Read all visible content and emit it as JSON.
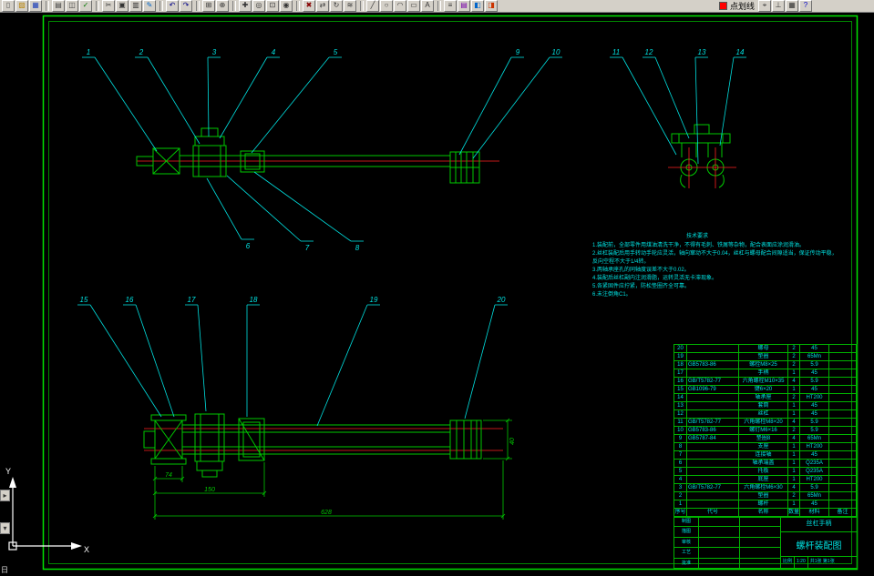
{
  "toolbar": {
    "groups": [
      {
        "items": [
          {
            "name": "new-file",
            "glyph": "▯",
            "color": "#555555"
          },
          {
            "name": "open-file",
            "glyph": "▨",
            "color": "#b8860b"
          },
          {
            "name": "save-file",
            "glyph": "▦",
            "color": "#2244bb"
          }
        ]
      },
      {
        "items": [
          {
            "name": "print",
            "glyph": "▤",
            "color": "#444444"
          },
          {
            "name": "print-preview",
            "glyph": "◫",
            "color": "#444444"
          },
          {
            "name": "spell-check",
            "glyph": "✓",
            "color": "#007700"
          }
        ]
      },
      {
        "items": [
          {
            "name": "cut",
            "glyph": "✂",
            "color": "#333333"
          },
          {
            "name": "copy",
            "glyph": "▣",
            "color": "#333333"
          },
          {
            "name": "paste",
            "glyph": "▥",
            "color": "#333333"
          },
          {
            "name": "format-painter",
            "glyph": "✎",
            "color": "#0066cc"
          }
        ]
      },
      {
        "items": [
          {
            "name": "undo",
            "glyph": "↶",
            "color": "#000088"
          },
          {
            "name": "redo",
            "glyph": "↷",
            "color": "#000088"
          }
        ]
      },
      {
        "items": [
          {
            "name": "insert-block",
            "glyph": "⊞",
            "color": "#333333"
          },
          {
            "name": "insert-hyperlink",
            "glyph": "⊕",
            "color": "#333333"
          }
        ]
      },
      {
        "items": [
          {
            "name": "pan",
            "glyph": "✚",
            "color": "#333333"
          },
          {
            "name": "zoom-realtime",
            "glyph": "◎",
            "color": "#333333"
          },
          {
            "name": "zoom-window",
            "glyph": "⊡",
            "color": "#333333"
          },
          {
            "name": "zoom-previous",
            "glyph": "◉",
            "color": "#333333"
          }
        ]
      },
      {
        "items": [
          {
            "name": "erase",
            "glyph": "✖",
            "color": "#880000"
          },
          {
            "name": "move",
            "glyph": "⇄",
            "color": "#333333"
          },
          {
            "name": "rotate",
            "glyph": "↻",
            "color": "#333333"
          },
          {
            "name": "offset",
            "glyph": "≋",
            "color": "#333333"
          }
        ]
      },
      {
        "items": [
          {
            "name": "line",
            "glyph": "╱",
            "color": "#333333"
          },
          {
            "name": "circle",
            "glyph": "○",
            "color": "#333333"
          },
          {
            "name": "arc",
            "glyph": "◠",
            "color": "#333333"
          },
          {
            "name": "rectangle",
            "glyph": "▭",
            "color": "#333333"
          },
          {
            "name": "text",
            "glyph": "A",
            "color": "#333333"
          }
        ]
      },
      {
        "items": [
          {
            "name": "layers",
            "glyph": "≡",
            "color": "#333333"
          },
          {
            "name": "layer-control",
            "glyph": "▤",
            "color": "#7700aa"
          },
          {
            "name": "properties",
            "glyph": "◧",
            "color": "#0066cc"
          },
          {
            "name": "design-center",
            "glyph": "◨",
            "color": "#cc3300"
          }
        ]
      }
    ],
    "linetype": {
      "label": "点划线",
      "color": "#ff0000"
    },
    "right_groups": [
      {
        "items": [
          {
            "name": "object-snap",
            "glyph": "⌖",
            "color": "#333333"
          },
          {
            "name": "ortho",
            "glyph": "⊥",
            "color": "#333333"
          },
          {
            "name": "grid",
            "glyph": "▦",
            "color": "#333333"
          },
          {
            "name": "help",
            "glyph": "?",
            "color": "#0000cc"
          }
        ]
      }
    ]
  },
  "callouts": {
    "top": [
      "1",
      "2",
      "3",
      "4",
      "5",
      "9",
      "10"
    ],
    "top_below": [
      "6",
      "7",
      "8"
    ],
    "end_view": [
      "11",
      "12",
      "13",
      "14"
    ],
    "bottom": [
      "15",
      "16",
      "17",
      "18",
      "19",
      "20"
    ]
  },
  "dimensions": {
    "d1": "74",
    "d2": "150",
    "d3": "628",
    "d4": "40"
  },
  "notes": {
    "title": "技术要求",
    "lines": [
      "1.装配前，全部零件用煤油清洗干净，不得有毛刺、铁屑等杂物，配合表面应涂润滑油。",
      "2.丝杠装配后用手转动手轮应灵活，轴向窜动不大于0.04，丝杠与螺母配合间隙适当，保证传动平稳，",
      "  反向空程不大于1/4转。",
      "3.两轴承座孔的同轴度误差不大于0.02。",
      "4.装配后丝杠副内注润滑脂，运转灵活无卡滞现象。",
      "5.各紧固件应拧紧，防松垫圈齐全可靠。",
      "6.未注倒角C1。"
    ]
  },
  "bom": {
    "header": [
      "序号",
      "代号",
      "名称",
      "数量",
      "材料",
      "备注"
    ],
    "rows": [
      {
        "no": "20",
        "code": "",
        "name": "螺母",
        "qty": "2",
        "mat": "45",
        "rem": ""
      },
      {
        "no": "19",
        "code": "",
        "name": "垫圈",
        "qty": "2",
        "mat": "65Mn",
        "rem": ""
      },
      {
        "no": "18",
        "code": "GB5783-86",
        "name": "螺栓M8×25",
        "qty": "2",
        "mat": "5.9",
        "rem": ""
      },
      {
        "no": "17",
        "code": "",
        "name": "手柄",
        "qty": "1",
        "mat": "45",
        "rem": ""
      },
      {
        "no": "16",
        "code": "GB/T5782-77",
        "name": "六角螺栓M10×35",
        "qty": "4",
        "mat": "5.9",
        "rem": ""
      },
      {
        "no": "15",
        "code": "GB1096-79",
        "name": "键6×20",
        "qty": "1",
        "mat": "45",
        "rem": ""
      },
      {
        "no": "14",
        "code": "",
        "name": "轴承座",
        "qty": "2",
        "mat": "HT200",
        "rem": ""
      },
      {
        "no": "13",
        "code": "",
        "name": "套筒",
        "qty": "1",
        "mat": "45",
        "rem": ""
      },
      {
        "no": "12",
        "code": "",
        "name": "丝杠",
        "qty": "1",
        "mat": "45",
        "rem": ""
      },
      {
        "no": "11",
        "code": "GB/T5782-77",
        "name": "六角螺栓M8×20",
        "qty": "4",
        "mat": "5.9",
        "rem": ""
      },
      {
        "no": "10",
        "code": "GB5783-86",
        "name": "螺钉M6×16",
        "qty": "2",
        "mat": "5.9",
        "rem": ""
      },
      {
        "no": "9",
        "code": "GB5787-84",
        "name": "垫圈8",
        "qty": "4",
        "mat": "65Mn",
        "rem": ""
      },
      {
        "no": "8",
        "code": "",
        "name": "支座",
        "qty": "1",
        "mat": "HT200",
        "rem": ""
      },
      {
        "no": "7",
        "code": "",
        "name": "连接轴",
        "qty": "1",
        "mat": "45",
        "rem": ""
      },
      {
        "no": "6",
        "code": "",
        "name": "轴承端盖",
        "qty": "1",
        "mat": "Q235A",
        "rem": ""
      },
      {
        "no": "5",
        "code": "",
        "name": "托板",
        "qty": "1",
        "mat": "Q235A",
        "rem": ""
      },
      {
        "no": "4",
        "code": "",
        "name": "底座",
        "qty": "1",
        "mat": "HT200",
        "rem": ""
      },
      {
        "no": "3",
        "code": "GB/T5782-77",
        "name": "六角螺栓M6×30",
        "qty": "4",
        "mat": "5.9",
        "rem": ""
      },
      {
        "no": "2",
        "code": "",
        "name": "垫圈",
        "qty": "2",
        "mat": "65Mn",
        "rem": ""
      },
      {
        "no": "1",
        "code": "",
        "name": "螺杆",
        "qty": "1",
        "mat": "45",
        "rem": ""
      }
    ]
  },
  "titleblock": {
    "part_title": "丝杠手柄",
    "drawing_title": "螺杆装配图",
    "scale_label": "比例",
    "scale_value": "1:20",
    "sheet_text": "共1张 第1张",
    "sign_rows": [
      "制图",
      "描图",
      "审核",
      "工艺",
      "批准"
    ]
  },
  "ucs": {
    "x_label": "X",
    "y_label": "Y"
  },
  "status": {
    "ime_indicator": "日"
  }
}
